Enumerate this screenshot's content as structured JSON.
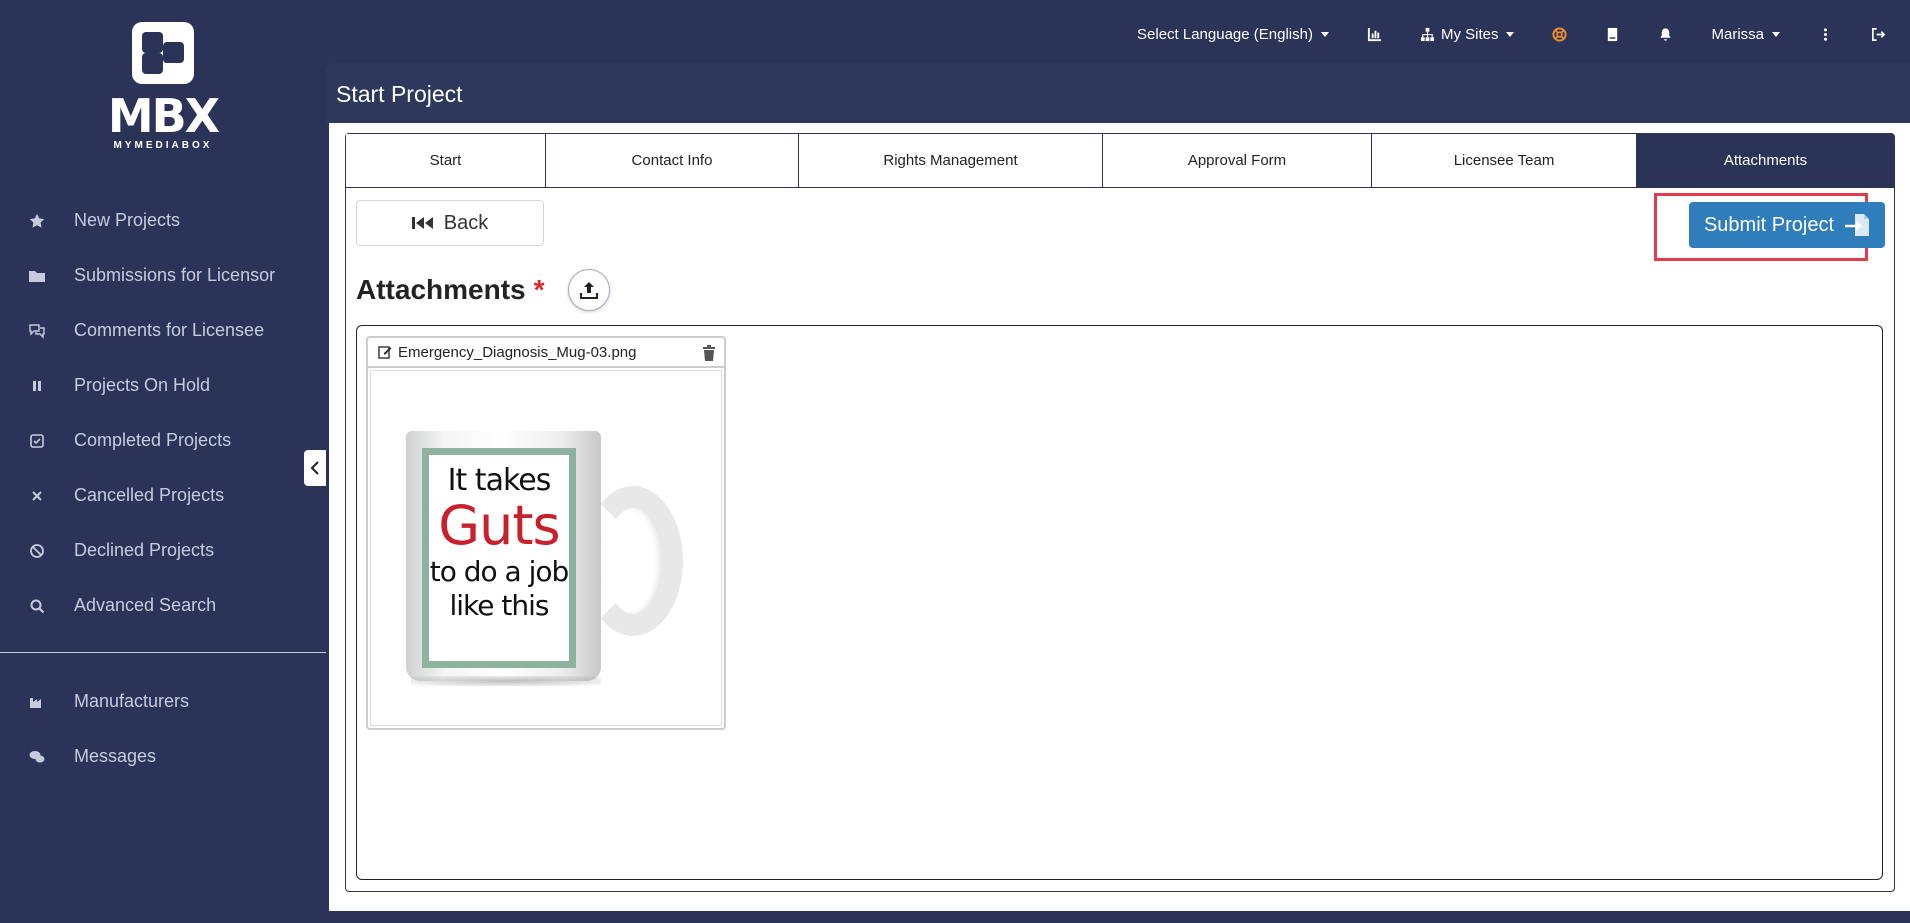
{
  "brand": {
    "name": "MBX",
    "tagline": "MYMEDIABOX"
  },
  "topbar": {
    "language": "Select Language (English)",
    "my_sites": "My Sites",
    "user": "Marissa"
  },
  "sidebar": {
    "items": [
      {
        "label": "New Projects",
        "icon": "star-icon"
      },
      {
        "label": "Submissions for Licensor",
        "icon": "folder-icon"
      },
      {
        "label": "Comments for Licensee",
        "icon": "comments-icon"
      },
      {
        "label": "Projects On Hold",
        "icon": "pause-icon"
      },
      {
        "label": "Completed Projects",
        "icon": "check-square-icon"
      },
      {
        "label": "Cancelled Projects",
        "icon": "x-icon"
      },
      {
        "label": "Declined Projects",
        "icon": "ban-icon"
      },
      {
        "label": "Advanced Search",
        "icon": "search-icon"
      }
    ],
    "secondary": [
      {
        "label": "Manufacturers",
        "icon": "industry-icon"
      },
      {
        "label": "Messages",
        "icon": "messages-icon"
      }
    ]
  },
  "page": {
    "title": "Start Project"
  },
  "tabs": [
    {
      "label": "Start"
    },
    {
      "label": "Contact Info"
    },
    {
      "label": "Rights Management"
    },
    {
      "label": "Approval Form"
    },
    {
      "label": "Licensee Team"
    },
    {
      "label": "Attachments",
      "active": true
    }
  ],
  "actions": {
    "back": "Back",
    "submit": "Submit Project"
  },
  "attachments": {
    "title": "Attachments",
    "required_mark": "*",
    "files": [
      {
        "name": "Emergency_Diagnosis_Mug-03.png",
        "preview_text": [
          "It takes",
          "Guts",
          "to do a job",
          "like this"
        ]
      }
    ]
  },
  "colors": {
    "sidebar_bg": "#2b3358",
    "active_tab": "#2b3358",
    "primary_button": "#2f7dba",
    "highlight": "#e23b4b",
    "required": "#d9262e",
    "support_icon": "#f28c28"
  }
}
